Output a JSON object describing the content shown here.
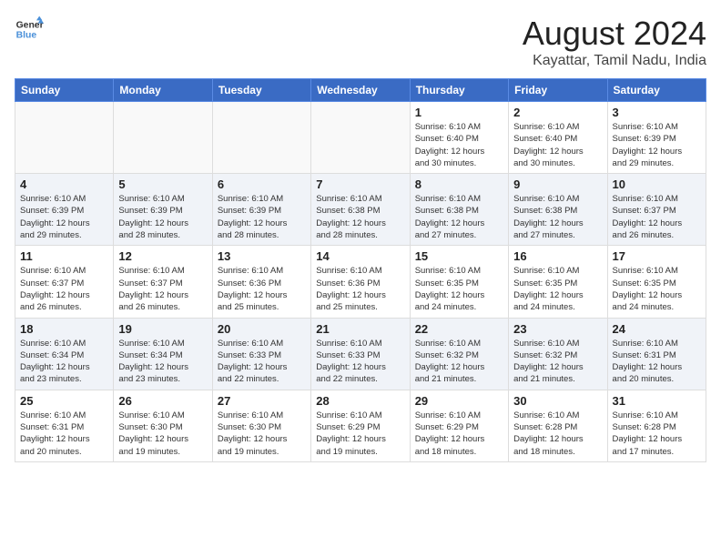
{
  "logo": {
    "line1": "General",
    "line2": "Blue"
  },
  "title": "August 2024",
  "location": "Kayattar, Tamil Nadu, India",
  "days_header": [
    "Sunday",
    "Monday",
    "Tuesday",
    "Wednesday",
    "Thursday",
    "Friday",
    "Saturday"
  ],
  "weeks": [
    [
      {
        "day": "",
        "detail": ""
      },
      {
        "day": "",
        "detail": ""
      },
      {
        "day": "",
        "detail": ""
      },
      {
        "day": "",
        "detail": ""
      },
      {
        "day": "1",
        "detail": "Sunrise: 6:10 AM\nSunset: 6:40 PM\nDaylight: 12 hours\nand 30 minutes."
      },
      {
        "day": "2",
        "detail": "Sunrise: 6:10 AM\nSunset: 6:40 PM\nDaylight: 12 hours\nand 30 minutes."
      },
      {
        "day": "3",
        "detail": "Sunrise: 6:10 AM\nSunset: 6:39 PM\nDaylight: 12 hours\nand 29 minutes."
      }
    ],
    [
      {
        "day": "4",
        "detail": "Sunrise: 6:10 AM\nSunset: 6:39 PM\nDaylight: 12 hours\nand 29 minutes."
      },
      {
        "day": "5",
        "detail": "Sunrise: 6:10 AM\nSunset: 6:39 PM\nDaylight: 12 hours\nand 28 minutes."
      },
      {
        "day": "6",
        "detail": "Sunrise: 6:10 AM\nSunset: 6:39 PM\nDaylight: 12 hours\nand 28 minutes."
      },
      {
        "day": "7",
        "detail": "Sunrise: 6:10 AM\nSunset: 6:38 PM\nDaylight: 12 hours\nand 28 minutes."
      },
      {
        "day": "8",
        "detail": "Sunrise: 6:10 AM\nSunset: 6:38 PM\nDaylight: 12 hours\nand 27 minutes."
      },
      {
        "day": "9",
        "detail": "Sunrise: 6:10 AM\nSunset: 6:38 PM\nDaylight: 12 hours\nand 27 minutes."
      },
      {
        "day": "10",
        "detail": "Sunrise: 6:10 AM\nSunset: 6:37 PM\nDaylight: 12 hours\nand 26 minutes."
      }
    ],
    [
      {
        "day": "11",
        "detail": "Sunrise: 6:10 AM\nSunset: 6:37 PM\nDaylight: 12 hours\nand 26 minutes."
      },
      {
        "day": "12",
        "detail": "Sunrise: 6:10 AM\nSunset: 6:37 PM\nDaylight: 12 hours\nand 26 minutes."
      },
      {
        "day": "13",
        "detail": "Sunrise: 6:10 AM\nSunset: 6:36 PM\nDaylight: 12 hours\nand 25 minutes."
      },
      {
        "day": "14",
        "detail": "Sunrise: 6:10 AM\nSunset: 6:36 PM\nDaylight: 12 hours\nand 25 minutes."
      },
      {
        "day": "15",
        "detail": "Sunrise: 6:10 AM\nSunset: 6:35 PM\nDaylight: 12 hours\nand 24 minutes."
      },
      {
        "day": "16",
        "detail": "Sunrise: 6:10 AM\nSunset: 6:35 PM\nDaylight: 12 hours\nand 24 minutes."
      },
      {
        "day": "17",
        "detail": "Sunrise: 6:10 AM\nSunset: 6:35 PM\nDaylight: 12 hours\nand 24 minutes."
      }
    ],
    [
      {
        "day": "18",
        "detail": "Sunrise: 6:10 AM\nSunset: 6:34 PM\nDaylight: 12 hours\nand 23 minutes."
      },
      {
        "day": "19",
        "detail": "Sunrise: 6:10 AM\nSunset: 6:34 PM\nDaylight: 12 hours\nand 23 minutes."
      },
      {
        "day": "20",
        "detail": "Sunrise: 6:10 AM\nSunset: 6:33 PM\nDaylight: 12 hours\nand 22 minutes."
      },
      {
        "day": "21",
        "detail": "Sunrise: 6:10 AM\nSunset: 6:33 PM\nDaylight: 12 hours\nand 22 minutes."
      },
      {
        "day": "22",
        "detail": "Sunrise: 6:10 AM\nSunset: 6:32 PM\nDaylight: 12 hours\nand 21 minutes."
      },
      {
        "day": "23",
        "detail": "Sunrise: 6:10 AM\nSunset: 6:32 PM\nDaylight: 12 hours\nand 21 minutes."
      },
      {
        "day": "24",
        "detail": "Sunrise: 6:10 AM\nSunset: 6:31 PM\nDaylight: 12 hours\nand 20 minutes."
      }
    ],
    [
      {
        "day": "25",
        "detail": "Sunrise: 6:10 AM\nSunset: 6:31 PM\nDaylight: 12 hours\nand 20 minutes."
      },
      {
        "day": "26",
        "detail": "Sunrise: 6:10 AM\nSunset: 6:30 PM\nDaylight: 12 hours\nand 19 minutes."
      },
      {
        "day": "27",
        "detail": "Sunrise: 6:10 AM\nSunset: 6:30 PM\nDaylight: 12 hours\nand 19 minutes."
      },
      {
        "day": "28",
        "detail": "Sunrise: 6:10 AM\nSunset: 6:29 PM\nDaylight: 12 hours\nand 19 minutes."
      },
      {
        "day": "29",
        "detail": "Sunrise: 6:10 AM\nSunset: 6:29 PM\nDaylight: 12 hours\nand 18 minutes."
      },
      {
        "day": "30",
        "detail": "Sunrise: 6:10 AM\nSunset: 6:28 PM\nDaylight: 12 hours\nand 18 minutes."
      },
      {
        "day": "31",
        "detail": "Sunrise: 6:10 AM\nSunset: 6:28 PM\nDaylight: 12 hours\nand 17 minutes."
      }
    ]
  ]
}
